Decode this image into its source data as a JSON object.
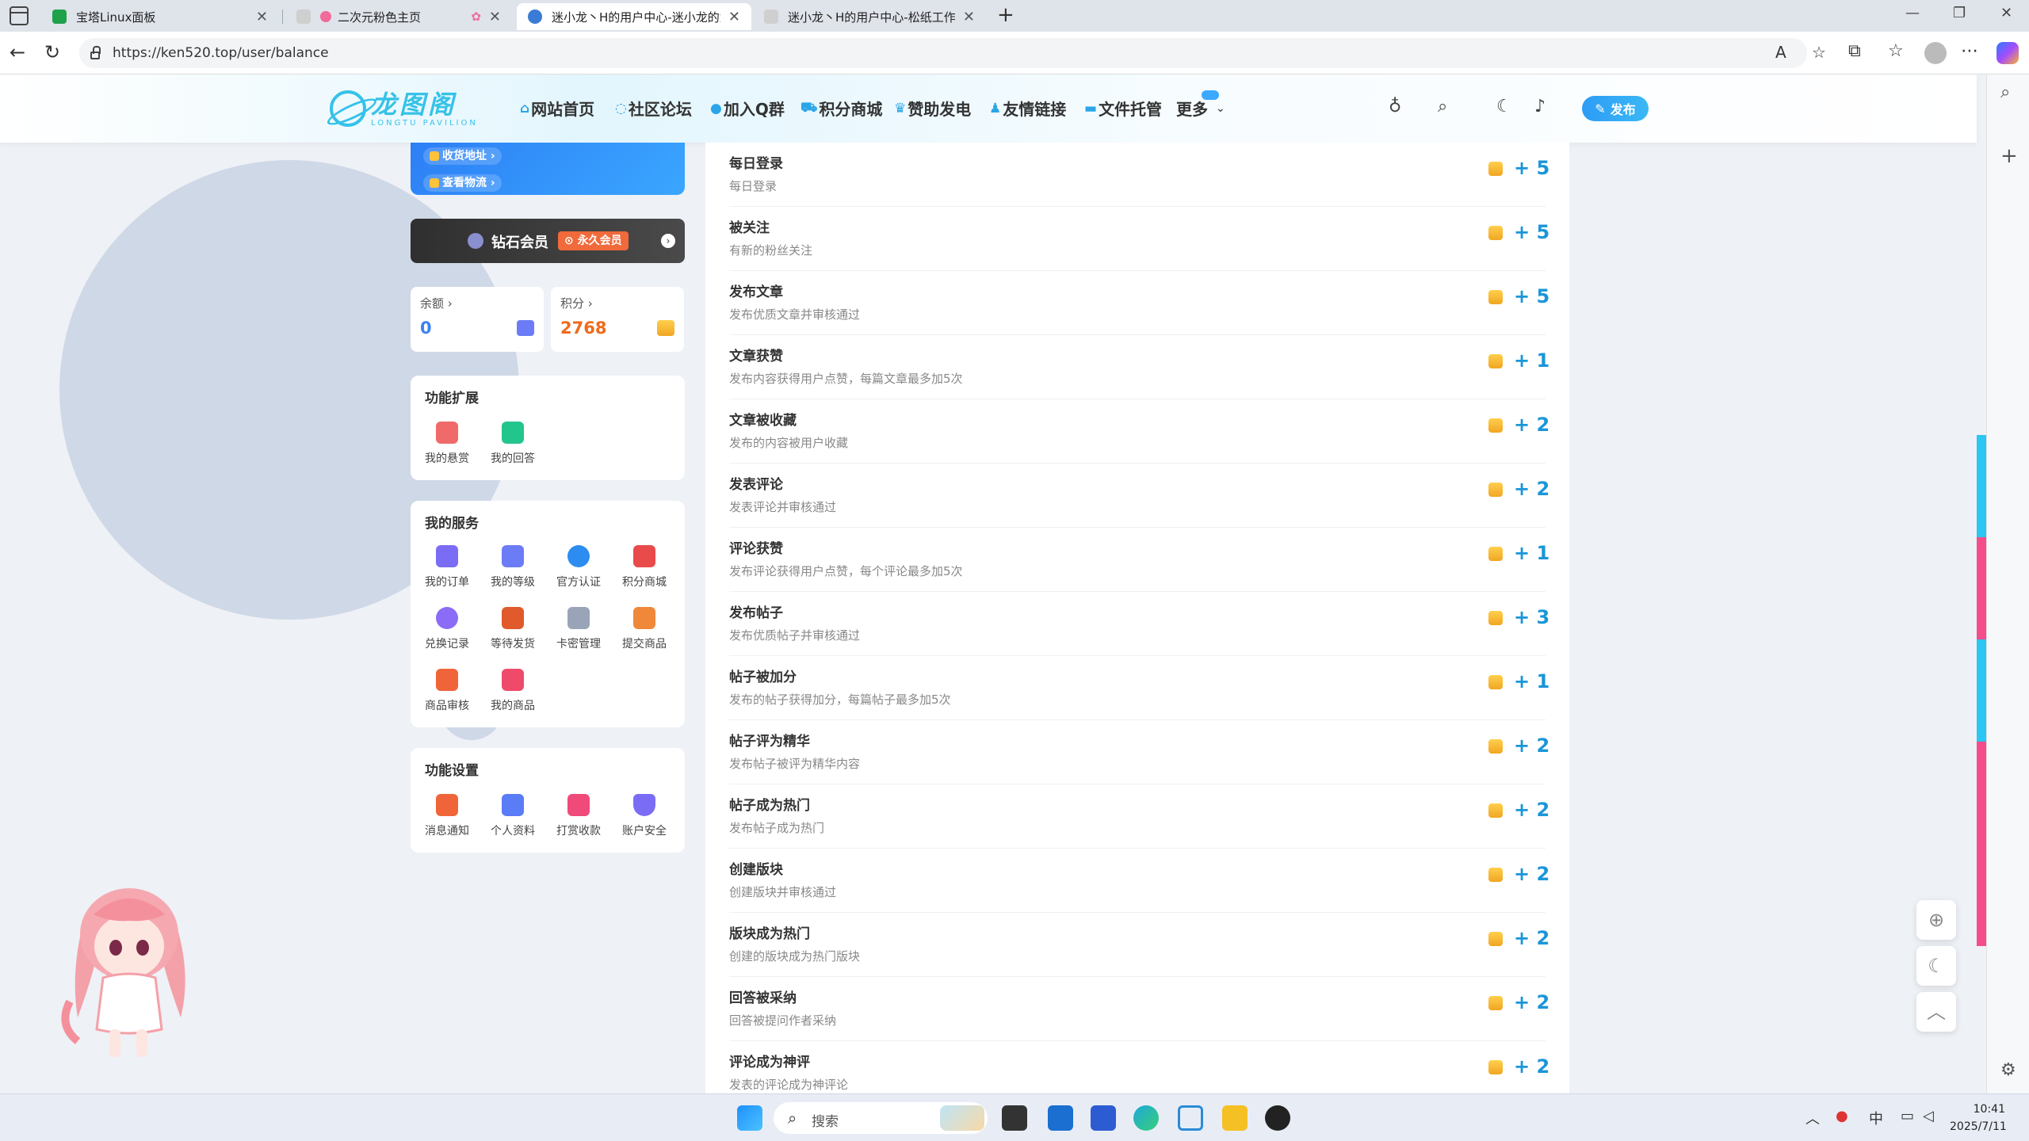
{
  "browser": {
    "tabs": [
      {
        "title": "宝塔Linux面板",
        "active": false
      },
      {
        "title": "二次元粉色主页",
        "active": false
      },
      {
        "title": "迷小龙丶H的用户中心-迷小龙的龙图阁",
        "active": true
      },
      {
        "title": "迷小龙丶H的用户中心-松纸工作室",
        "active": false
      }
    ],
    "url": "https://ken520.top/user/balance",
    "icons": [
      "back-icon",
      "refresh-icon",
      "lock-icon",
      "read-aloud-icon",
      "favorite-star-icon",
      "extensions-icon",
      "collections-icon",
      "profile-icon",
      "more-icon",
      "copilot-icon"
    ]
  },
  "site": {
    "logo_cn": "龙图阁",
    "logo_en": "LONGTU PAVILION",
    "nav": [
      {
        "label": "网站首页",
        "icon": "home-icon"
      },
      {
        "label": "社区论坛",
        "icon": "forum-icon"
      },
      {
        "label": "加入Q群",
        "icon": "penguin-icon"
      },
      {
        "label": "积分商城",
        "icon": "cart-icon"
      },
      {
        "label": "赞助发电",
        "icon": "crown-icon"
      },
      {
        "label": "友情链接",
        "icon": "user-icon"
      },
      {
        "label": "文件托管",
        "icon": "folder-icon"
      },
      {
        "label": "更多",
        "icon": "chevron-down-icon"
      }
    ],
    "publish_label": "发布"
  },
  "sidebar": {
    "blue_links": [
      "收货地址",
      "查看物流"
    ],
    "vip": {
      "label": "钻石会员",
      "badge": "永久会员"
    },
    "balance": {
      "label": "余额",
      "value": "0",
      "color": "#3b82f6"
    },
    "points": {
      "label": "积分",
      "value": "2768",
      "color": "#f06a1a"
    },
    "extensions": {
      "title": "功能扩展",
      "items": [
        {
          "label": "我的悬赏",
          "icon": "bounty-icon",
          "color": "#f06a6a"
        },
        {
          "label": "我的回答",
          "icon": "chat-icon",
          "color": "#22c58b"
        }
      ]
    },
    "services": {
      "title": "我的服务",
      "items": [
        {
          "label": "我的订单",
          "icon": "order-icon",
          "color": "#7b6cf6"
        },
        {
          "label": "我的等级",
          "icon": "level-icon",
          "color": "#6b7cf6"
        },
        {
          "label": "官方认证",
          "icon": "verified-icon",
          "color": "#2d8cf0"
        },
        {
          "label": "积分商城",
          "icon": "store-icon",
          "color": "#e94b4b"
        },
        {
          "label": "兑换记录",
          "icon": "exchange-icon",
          "color": "#8a6cf6"
        },
        {
          "label": "等待发货",
          "icon": "truck-icon",
          "color": "#e05a2b"
        },
        {
          "label": "卡密管理",
          "icon": "card-icon",
          "color": "#9aa4b8"
        },
        {
          "label": "提交商品",
          "icon": "submit-icon",
          "color": "#f0883a"
        },
        {
          "label": "商品审核",
          "icon": "review-icon",
          "color": "#f0643a"
        },
        {
          "label": "我的商品",
          "icon": "bag-icon",
          "color": "#f04a6a"
        }
      ]
    },
    "settings": {
      "title": "功能设置",
      "items": [
        {
          "label": "消息通知",
          "icon": "bell-icon",
          "color": "#f0643a"
        },
        {
          "label": "个人资料",
          "icon": "profile-card-icon",
          "color": "#5a7cf6"
        },
        {
          "label": "打赏收款",
          "icon": "gift-icon",
          "color": "#f04a7a"
        },
        {
          "label": "账户安全",
          "icon": "shield-icon",
          "color": "#7b6cf6"
        }
      ]
    }
  },
  "points_rules": [
    {
      "title": "每日登录",
      "desc": "每日登录",
      "points": "+ 5"
    },
    {
      "title": "被关注",
      "desc": "有新的粉丝关注",
      "points": "+ 5"
    },
    {
      "title": "发布文章",
      "desc": "发布优质文章并审核通过",
      "points": "+ 5"
    },
    {
      "title": "文章获赞",
      "desc": "发布内容获得用户点赞，每篇文章最多加5次",
      "points": "+ 1"
    },
    {
      "title": "文章被收藏",
      "desc": "发布的内容被用户收藏",
      "points": "+ 2"
    },
    {
      "title": "发表评论",
      "desc": "发表评论并审核通过",
      "points": "+ 2"
    },
    {
      "title": "评论获赞",
      "desc": "发布评论获得用户点赞，每个评论最多加5次",
      "points": "+ 1"
    },
    {
      "title": "发布帖子",
      "desc": "发布优质帖子并审核通过",
      "points": "+ 3"
    },
    {
      "title": "帖子被加分",
      "desc": "发布的帖子获得加分，每篇帖子最多加5次",
      "points": "+ 1"
    },
    {
      "title": "帖子评为精华",
      "desc": "发布帖子被评为精华内容",
      "points": "+ 2"
    },
    {
      "title": "帖子成为热门",
      "desc": "发布帖子成为热门",
      "points": "+ 2"
    },
    {
      "title": "创建版块",
      "desc": "创建版块并审核通过",
      "points": "+ 2"
    },
    {
      "title": "版块成为热门",
      "desc": "创建的版块成为热门版块",
      "points": "+ 2"
    },
    {
      "title": "回答被采纳",
      "desc": "回答被提问作者采纳",
      "points": "+ 2"
    },
    {
      "title": "评论成为神评",
      "desc": "发表的评论成为神评论",
      "points": "+ 2"
    }
  ],
  "taskbar": {
    "search_placeholder": "搜索",
    "ime": "中",
    "time": "10:41",
    "date": "2025/7/11"
  }
}
